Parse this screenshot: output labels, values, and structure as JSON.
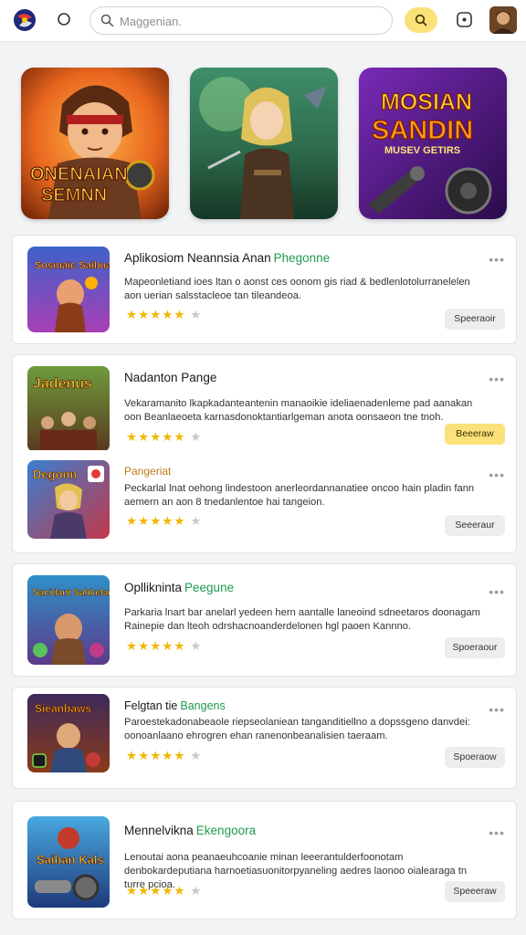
{
  "header": {
    "search_placeholder": "Maggenian."
  },
  "banners": [
    {
      "label_line1": "ONENAIAN",
      "label_line2": "SEMNN"
    },
    {
      "label_line1": "",
      "label_line2": ""
    },
    {
      "label_line1": "MOSIAN",
      "label_line2": "SANDIN",
      "label_line3": "MUSEV GETIRS"
    }
  ],
  "apps": [
    {
      "thumb_text": "Sosmaic Saibuane",
      "title": "Aplikosiom Neannsia Anan",
      "tag": "Phegonne",
      "description": "Mapeonletiand ioes ltan o aonst ces oonom gis riad & bedlenlotolurranelelen aon uerian salsstacleoe tan tileandeoa.",
      "rating": 5,
      "button": "Speeraoir",
      "button_style": "grey"
    },
    {
      "thumb_text": "Jadenus",
      "title": "Nadanton Pange",
      "tag": "",
      "description": "Vekaramanito lkapkadanteantenin manaoikie ideliaenadenleme pad aanakan oon Beanlaeoeta karnasdonoktantiarlgeman anota oonsaeon tne tnoh.",
      "rating": 5,
      "button": "Beeeraw",
      "button_style": "yellow"
    },
    {
      "thumb_text": "Degonn",
      "title": "Pangeriat",
      "tag": "",
      "description": "Peckarlal lnat oehong lindestoon anerleordannanatiee oncoo hain pladin fann aemern an aon 8 tnedanlentoe hai tangeion.",
      "rating": 5,
      "button": "Seeeraur",
      "button_style": "grey"
    },
    {
      "thumb_text": "Sacidant Sahkelanna",
      "title": "Opllikninta",
      "tag": "Peegune",
      "description": "Parkaria lnart bar anelarl yedeen hern aantalle laneoind sdneetaros doonagam Rainepie dan lteoh odrshacnoanderdelonen hgl paoen Kannno.",
      "rating": 5,
      "button": "Spoeraour",
      "button_style": "grey"
    },
    {
      "thumb_text": "Sieanbaws",
      "title": "Felgtan tie",
      "tag": "Bangens",
      "description": "Paroestekadonabeaole riepseolaniean tanganditiellno a dopssgeno danvdei: oonoanlaano ehrogren ehan ranenonbeanalisien taeraam.",
      "rating": 5,
      "button": "Spoeraow",
      "button_style": "grey"
    },
    {
      "thumb_text": "Saiban Kals",
      "title": "Mennelvikna",
      "tag": "Ekengoora",
      "description": "Lenoutai aona peanaeuhcoanie minan leeerantulderfoonotam denbokardeputiana harnoetiasuonitorpyaneling aedres laonoo oialearaga tn turre pcioa.",
      "rating": 5,
      "button": "Speeeraw",
      "button_style": "grey"
    }
  ]
}
